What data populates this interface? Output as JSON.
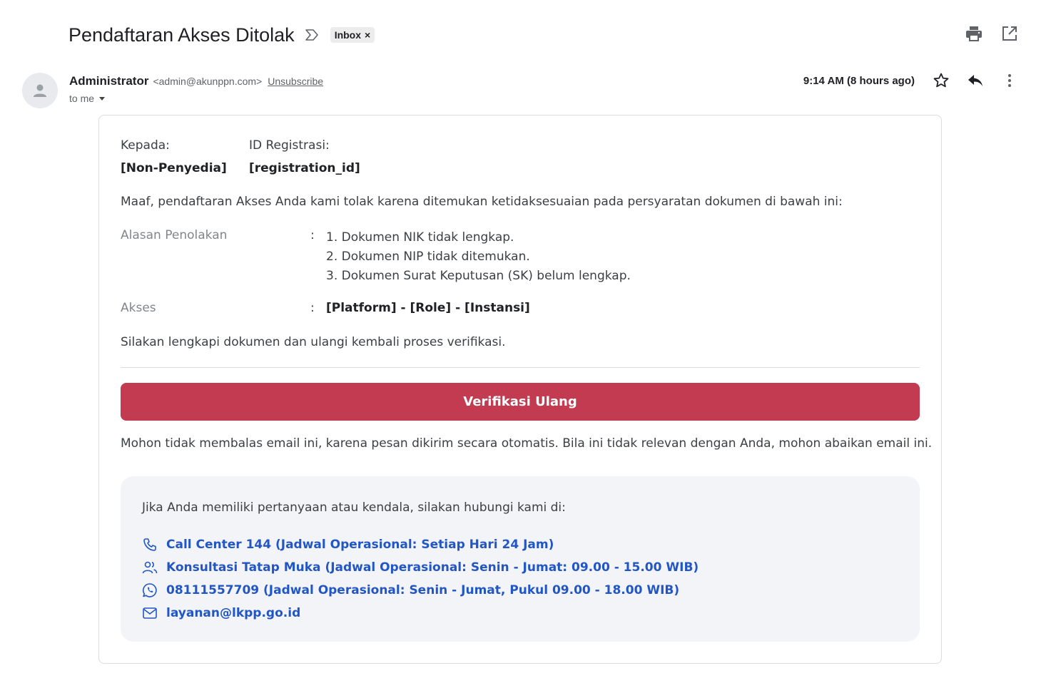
{
  "header": {
    "subject": "Pendaftaran Akses Ditolak",
    "label_chip": "Inbox",
    "label_remove": "×"
  },
  "sender": {
    "name": "Administrator",
    "email": "<admin@akunppn.com>",
    "unsubscribe": "Unsubscribe",
    "to": "to me",
    "time": "9:14 AM (8 hours ago)"
  },
  "email": {
    "kepada_label": "Kepada:",
    "kepada_value": "[Non-Penyedia]",
    "id_label": "ID Registrasi:",
    "id_value": "[registration_id]",
    "intro": "Maaf, pendaftaran Akses Anda kami tolak karena ditemukan ketidaksesuaian pada persyaratan dokumen di bawah ini:",
    "reason_label": "Alasan Penolakan",
    "reasons": [
      "1. Dokumen NIK tidak lengkap.",
      "2. Dokumen NIP tidak ditemukan.",
      "3. Dokumen Surat Keputusan (SK) belum lengkap."
    ],
    "akses_label": "Akses",
    "akses_value": "[Platform] - [Role] - [Instansi]",
    "colon": ":",
    "closing": "Silakan lengkapi dokumen dan ulangi kembali proses verifikasi.",
    "button_label": "Verifikasi Ulang",
    "notice": "Mohon tidak membalas email ini, karena pesan dikirim secara otomatis. Bila ini tidak relevan dengan Anda, mohon abaikan email ini.",
    "contact_intro": "Jika Anda memiliki pertanyaan atau kendala, silakan hubungi kami di:",
    "contacts": [
      {
        "icon": "phone-icon",
        "text": "Call Center 144 (Jadwal Operasional: Setiap Hari 24 Jam)"
      },
      {
        "icon": "people-icon",
        "text": "Konsultasi Tatap Muka (Jadwal Operasional: Senin - Jumat: 09.00 - 15.00 WIB)"
      },
      {
        "icon": "whatsapp-icon",
        "text": "08111557709 (Jadwal Operasional: Senin - Jumat, Pukul 09.00 - 18.00 WIB)"
      },
      {
        "icon": "mail-icon",
        "text": "layanan@lkpp.go.id"
      }
    ]
  },
  "colors": {
    "button": "#c23b50",
    "link": "#2156c4",
    "contact_bg": "#f3f4f7"
  }
}
